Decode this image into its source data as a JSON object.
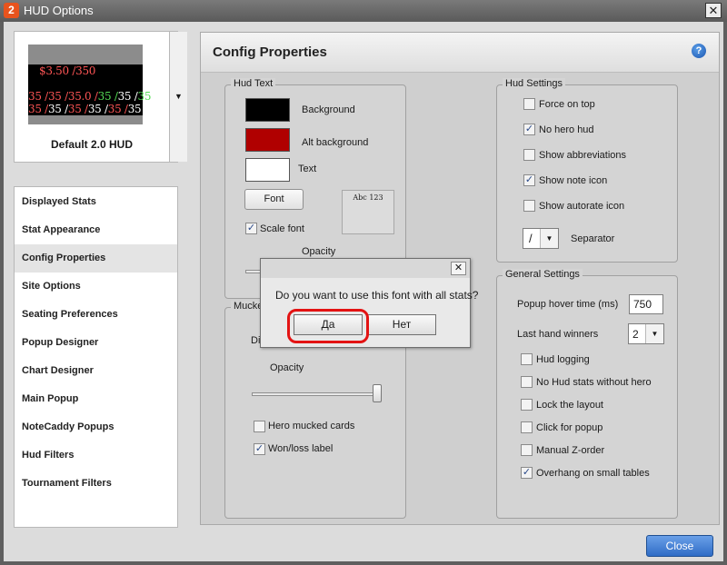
{
  "window": {
    "title": "HUD Options",
    "icon_text": "2",
    "close_glyph": "✕"
  },
  "hud_preview": {
    "name": "Default 2.0 HUD",
    "line1": [
      {
        "text": "$3.50 /",
        "color": "#ff5555"
      },
      {
        "text": "350",
        "color": "#ff5555"
      }
    ],
    "line2": [
      {
        "text": "35 /",
        "color": "#ff5555"
      },
      {
        "text": "35 /",
        "color": "#ff5555"
      },
      {
        "text": "35.0 /",
        "color": "#ff5555"
      },
      {
        "text": "35 /",
        "color": "#55dd55"
      },
      {
        "text": "35 /",
        "color": "#ffffff"
      },
      {
        "text": "35",
        "color": "#55dd55"
      }
    ],
    "line3": [
      {
        "text": "35 /",
        "color": "#ff5555"
      },
      {
        "text": "35 /",
        "color": "#ffffff"
      },
      {
        "text": "35 /",
        "color": "#ff5555"
      },
      {
        "text": "35 /",
        "color": "#ffffff"
      },
      {
        "text": "35 /",
        "color": "#ff5555"
      },
      {
        "text": "35",
        "color": "#ffffff"
      }
    ]
  },
  "nav": {
    "items": [
      "Displayed Stats",
      "Stat Appearance",
      "Config Properties",
      "Site Options",
      "Seating Preferences",
      "Popup Designer",
      "Chart Designer",
      "Main Popup",
      "NoteCaddy Popups",
      "Hud Filters",
      "Tournament Filters"
    ],
    "active": "Config Properties"
  },
  "main": {
    "title": "Config Properties",
    "help_glyph": "?",
    "hud_text": {
      "legend": "Hud Text",
      "background_label": "Background",
      "background_color": "#000000",
      "alt_background_label": "Alt background",
      "alt_background_color": "#b00000",
      "text_label": "Text",
      "text_color": "#ffffff",
      "font_button": "Font",
      "font_preview": "Abc 123",
      "scale_font_label": "Scale font",
      "scale_font_checked": true,
      "opacity_label": "Opacity"
    },
    "mucked": {
      "legend": "Mucke",
      "di_label": "Di",
      "opacity_label": "Opacity",
      "opacity_value": 1.0,
      "hero_mucked_label": "Hero mucked cards",
      "hero_mucked_checked": false,
      "won_loss_label": "Won/loss label",
      "won_loss_checked": true
    },
    "hud_settings": {
      "legend": "Hud Settings",
      "options": [
        {
          "label": "Force on top",
          "checked": false
        },
        {
          "label": "No hero hud",
          "checked": true
        },
        {
          "label": "Show abbreviations",
          "checked": false
        },
        {
          "label": "Show note icon",
          "checked": true
        },
        {
          "label": "Show autorate icon",
          "checked": false
        }
      ],
      "separator_value": "/",
      "separator_label": "Separator"
    },
    "general_settings": {
      "legend": "General Settings",
      "popup_hover_label": "Popup hover time (ms)",
      "popup_hover_value": "750",
      "last_hand_label": "Last hand winners",
      "last_hand_value": "2",
      "options": [
        {
          "label": "Hud logging",
          "checked": false
        },
        {
          "label": "No Hud stats without hero",
          "checked": false
        },
        {
          "label": "Lock the layout",
          "checked": false
        },
        {
          "label": "Click for popup",
          "checked": false
        },
        {
          "label": "Manual Z-order",
          "checked": false
        },
        {
          "label": "Overhang on small tables",
          "checked": true
        }
      ]
    }
  },
  "close_button": "Close",
  "dialog": {
    "message": "Do you want to use this font with all stats?",
    "yes": "Да",
    "no": "Нет",
    "close_glyph": "✕"
  },
  "dropdown_glyph": "▼"
}
